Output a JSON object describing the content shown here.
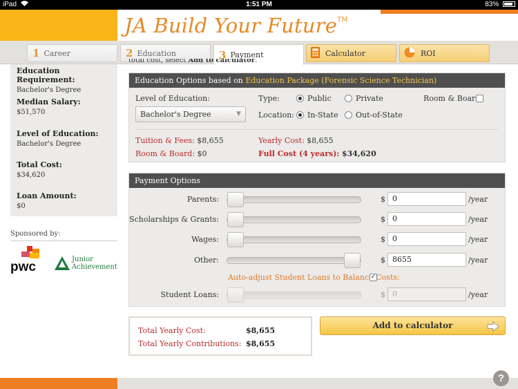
{
  "status_bar": {
    "device": "iPad",
    "time": "1:51 PM",
    "battery": "83%"
  },
  "header": {
    "title": "JA Build Your Future",
    "trademark": "TM"
  },
  "tabs": [
    {
      "num": "1",
      "label": "Career"
    },
    {
      "num": "2",
      "label": "Education"
    },
    {
      "num": "3",
      "label": "Payment"
    },
    {
      "label": "Calculator",
      "icon": "calculator-icon"
    },
    {
      "label": "ROI",
      "icon": "pie-chart-icon"
    }
  ],
  "sidebar": {
    "items": [
      {
        "label": "Education Requirement:",
        "value": "Bachelor's Degree"
      },
      {
        "label": "Median Salary:",
        "value": "$51,570"
      },
      {
        "label": "Level of Education:",
        "value": "Bachelor's Degree"
      },
      {
        "label": "Total Cost:",
        "value": "$34,620"
      },
      {
        "label": "Loan Amount:",
        "value": "$0"
      }
    ],
    "sponsored_by": "Sponsored by:",
    "sponsor1": "pwc",
    "sponsor2_line1": "Junior",
    "sponsor2_line2": "Achievement"
  },
  "clipped_text": {
    "prefix": "total cost, select ",
    "bold": "Add to calculator",
    "suffix": "."
  },
  "education_options": {
    "title_prefix": "Education Options based on ",
    "title_highlight": "Education Package (Forensic Science Technician)",
    "level_label": "Level of Education:",
    "level_value": "Bachelor's Degree",
    "type_label": "Type:",
    "type_public": "Public",
    "type_private": "Private",
    "type_selected": "Public",
    "location_label": "Location:",
    "location_instate": "In-State",
    "location_outstate": "Out-of-State",
    "location_selected": "In-State",
    "room_board_label": "Room & Board:",
    "room_board_checked": false,
    "tuition_label": "Tuition & Fees:",
    "tuition_value": "$8,655",
    "room_label": "Room & Board:",
    "room_value": "$0",
    "yearly_label": "Yearly Cost:",
    "yearly_value": "$8,655",
    "full_label": "Full Cost (4 years):",
    "full_value": "$34,620"
  },
  "payment_options": {
    "title": "Payment Options",
    "currency": "$",
    "per_year": "/year",
    "rows": [
      {
        "label": "Parents:",
        "value": "0",
        "level": 0
      },
      {
        "label": "Scholarships & Grants:",
        "value": "0",
        "level": 0
      },
      {
        "label": "Wages:",
        "value": "0",
        "level": 0
      },
      {
        "label": "Other:",
        "value": "8655",
        "level": 1
      }
    ],
    "auto_adjust_label": "Auto-adjust Student Loans to Balance Costs:",
    "auto_adjust_checked": true,
    "student_loans_label": "Student Loans:",
    "student_loans_value": "0"
  },
  "totals": {
    "yearly_cost_label": "Total Yearly Cost:",
    "yearly_cost_value": "$8,655",
    "yearly_contrib_label": "Total Yearly Contributions:",
    "yearly_contrib_value": "$8,655"
  },
  "add_button": "Add to calculator",
  "help": "?",
  "colors": {
    "brand_orange": "#e58a26",
    "yellow": "#f9b418",
    "red_label": "#b82a2a"
  }
}
